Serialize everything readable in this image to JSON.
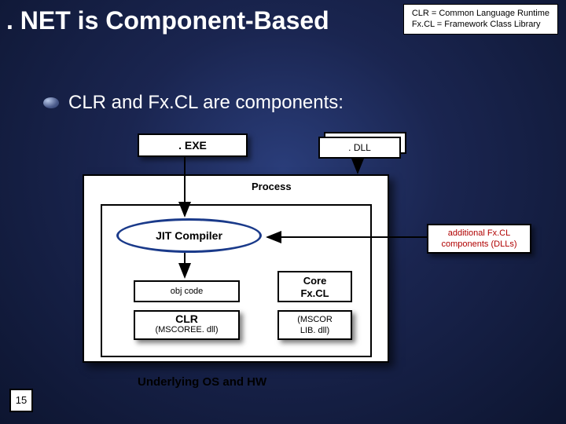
{
  "title": ". NET is Component-Based",
  "legend": {
    "line1": "CLR = Common Language Runtime",
    "line2": "Fx.CL = Framework Class Library"
  },
  "subtitle": "CLR and Fx.CL are components:",
  "boxes": {
    "exe": ". EXE",
    "dll": ". DLL",
    "process": "Process",
    "jit": "JIT Compiler",
    "objcode": "obj code",
    "clr_title": "CLR",
    "clr_sub": "(MSCOREE. dll)",
    "corefxcl_l1": "Core",
    "corefxcl_l2": "Fx.CL",
    "mscorlib_l1": "(MSCOR",
    "mscorlib_l2": "LIB. dll)",
    "additional_l1": "additional Fx.CL",
    "additional_l2": "components (DLLs)",
    "underlying": "Underlying OS and HW"
  },
  "slide_number": "15"
}
